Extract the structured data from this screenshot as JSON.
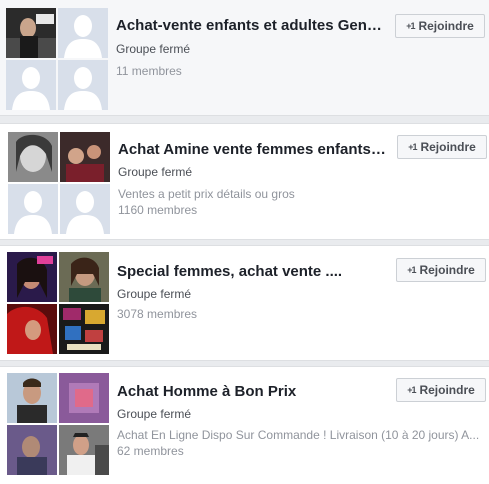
{
  "groups": [
    {
      "title": "Achat-vente enfants et adultes Genève",
      "status": "Groupe fermé",
      "description": "",
      "members": "11 membres",
      "join_label": "Rejoindre",
      "join_icon": "+1",
      "thumbs": [
        "photo",
        "silhouette",
        "silhouette",
        "silhouette"
      ]
    },
    {
      "title": "Achat Amine vente femmes enfants gar...",
      "status": "Groupe fermé",
      "description": "Ventes a petit prix détails ou gros",
      "members": "1160 membres",
      "join_label": "Rejoindre",
      "join_icon": "+1",
      "thumbs": [
        "photo",
        "photo",
        "silhouette",
        "silhouette"
      ]
    },
    {
      "title": "Special femmes, achat vente ....",
      "status": "Groupe fermé",
      "description": "",
      "members": "3078 membres",
      "join_label": "Rejoindre",
      "join_icon": "+1",
      "thumbs": [
        "photo",
        "photo",
        "photo",
        "photo"
      ]
    },
    {
      "title": "Achat Homme à Bon Prix",
      "status": "Groupe fermé",
      "description": "Achat En Ligne Dispo Sur Commande ! Livraison (10 à 20 jours) A...",
      "members": "62 membres",
      "join_label": "Rejoindre",
      "join_icon": "+1",
      "thumbs": [
        "photo",
        "photo",
        "photo",
        "photo"
      ]
    }
  ],
  "colors": {
    "title": "#1d2129",
    "secondary": "#90949c",
    "placeholder_bg": "#d8dfea",
    "silhouette": "#ffffff",
    "button_bg": "#f6f7f9"
  }
}
